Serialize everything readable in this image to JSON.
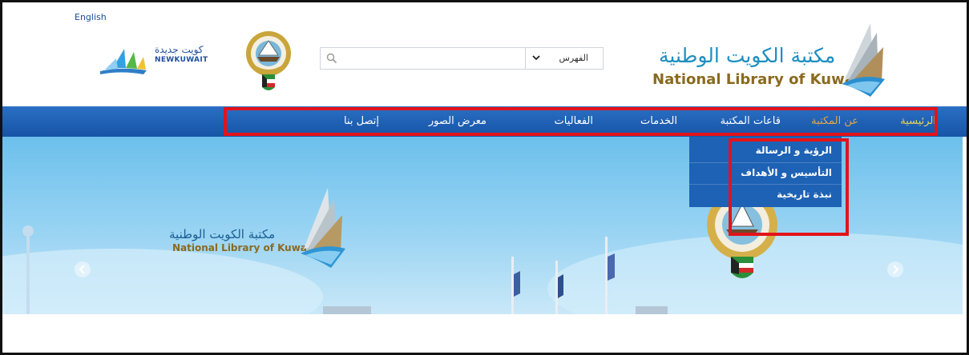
{
  "header": {
    "language_link": "English",
    "newkuwait_logo": {
      "arabic_text": "كويت جديدة",
      "latin_text": "NEWKUWAIT",
      "icon": "new-kuwait-sail-logo"
    },
    "emblem_icon": "kuwait-coat-of-arms",
    "library_logo": {
      "arabic": "مكتبة الكويت الوطنية",
      "english": "National Library of Kuwait",
      "icon": "library-book-logo"
    }
  },
  "search": {
    "placeholder": "",
    "value": "",
    "catalog_select": "الفهرس",
    "search_icon": "search-icon",
    "chevron_icon": "chevron-down-icon"
  },
  "nav": {
    "items": [
      {
        "label": "الرئيسية",
        "color": "#e7d45a"
      },
      {
        "label": "عن المكتبة",
        "color": "#e7a44a"
      },
      {
        "label": "قاعات المكتبة"
      },
      {
        "label": "الخدمات"
      },
      {
        "label": "الفعاليات"
      },
      {
        "label": "معرض الصور"
      },
      {
        "label": "إتصل بنا"
      }
    ]
  },
  "dropdown": {
    "items": [
      {
        "label": "الرؤية و الرسالة"
      },
      {
        "label": "التأسيس و الأهداف"
      },
      {
        "label": "نبذة تاريخية"
      }
    ]
  },
  "hero": {
    "library_logo": {
      "arabic": "مكتبة الكويت الوطنية",
      "english": "National Library of Kuwait"
    },
    "prev_icon": "chevron-left-icon",
    "next_icon": "chevron-right-icon"
  },
  "colors": {
    "nav_blue": "#1d5fb0",
    "highlight_red": "#e3131a",
    "sky": "#7cc7ee"
  }
}
